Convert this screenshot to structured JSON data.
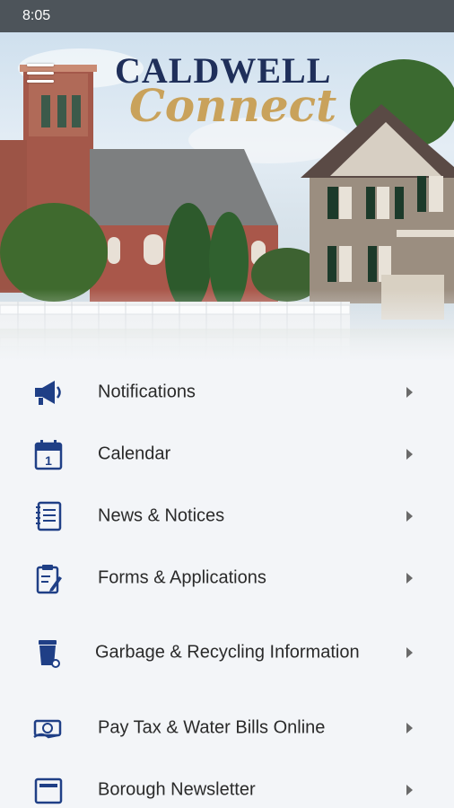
{
  "status_bar": {
    "time": "8:05"
  },
  "header": {
    "logo_line1": "CALDWELL",
    "logo_line2": "Connect"
  },
  "colors": {
    "navy": "#1f2f5a",
    "gold": "#c9a25b",
    "icon_blue": "#1f3f86"
  },
  "menu": {
    "items": [
      {
        "label": "Notifications",
        "icon": "megaphone-icon"
      },
      {
        "label": "Calendar",
        "icon": "calendar-icon"
      },
      {
        "label": "News & Notices",
        "icon": "notepad-icon"
      },
      {
        "label": "Forms & Applications",
        "icon": "clipboard-icon"
      },
      {
        "label": "Garbage & Recycling Information",
        "icon": "trash-bin-icon"
      },
      {
        "label": "Pay Tax & Water Bills Online",
        "icon": "money-hand-icon"
      },
      {
        "label": "Borough Newsletter",
        "icon": "newsletter-icon"
      }
    ],
    "calendar_day": "1"
  }
}
